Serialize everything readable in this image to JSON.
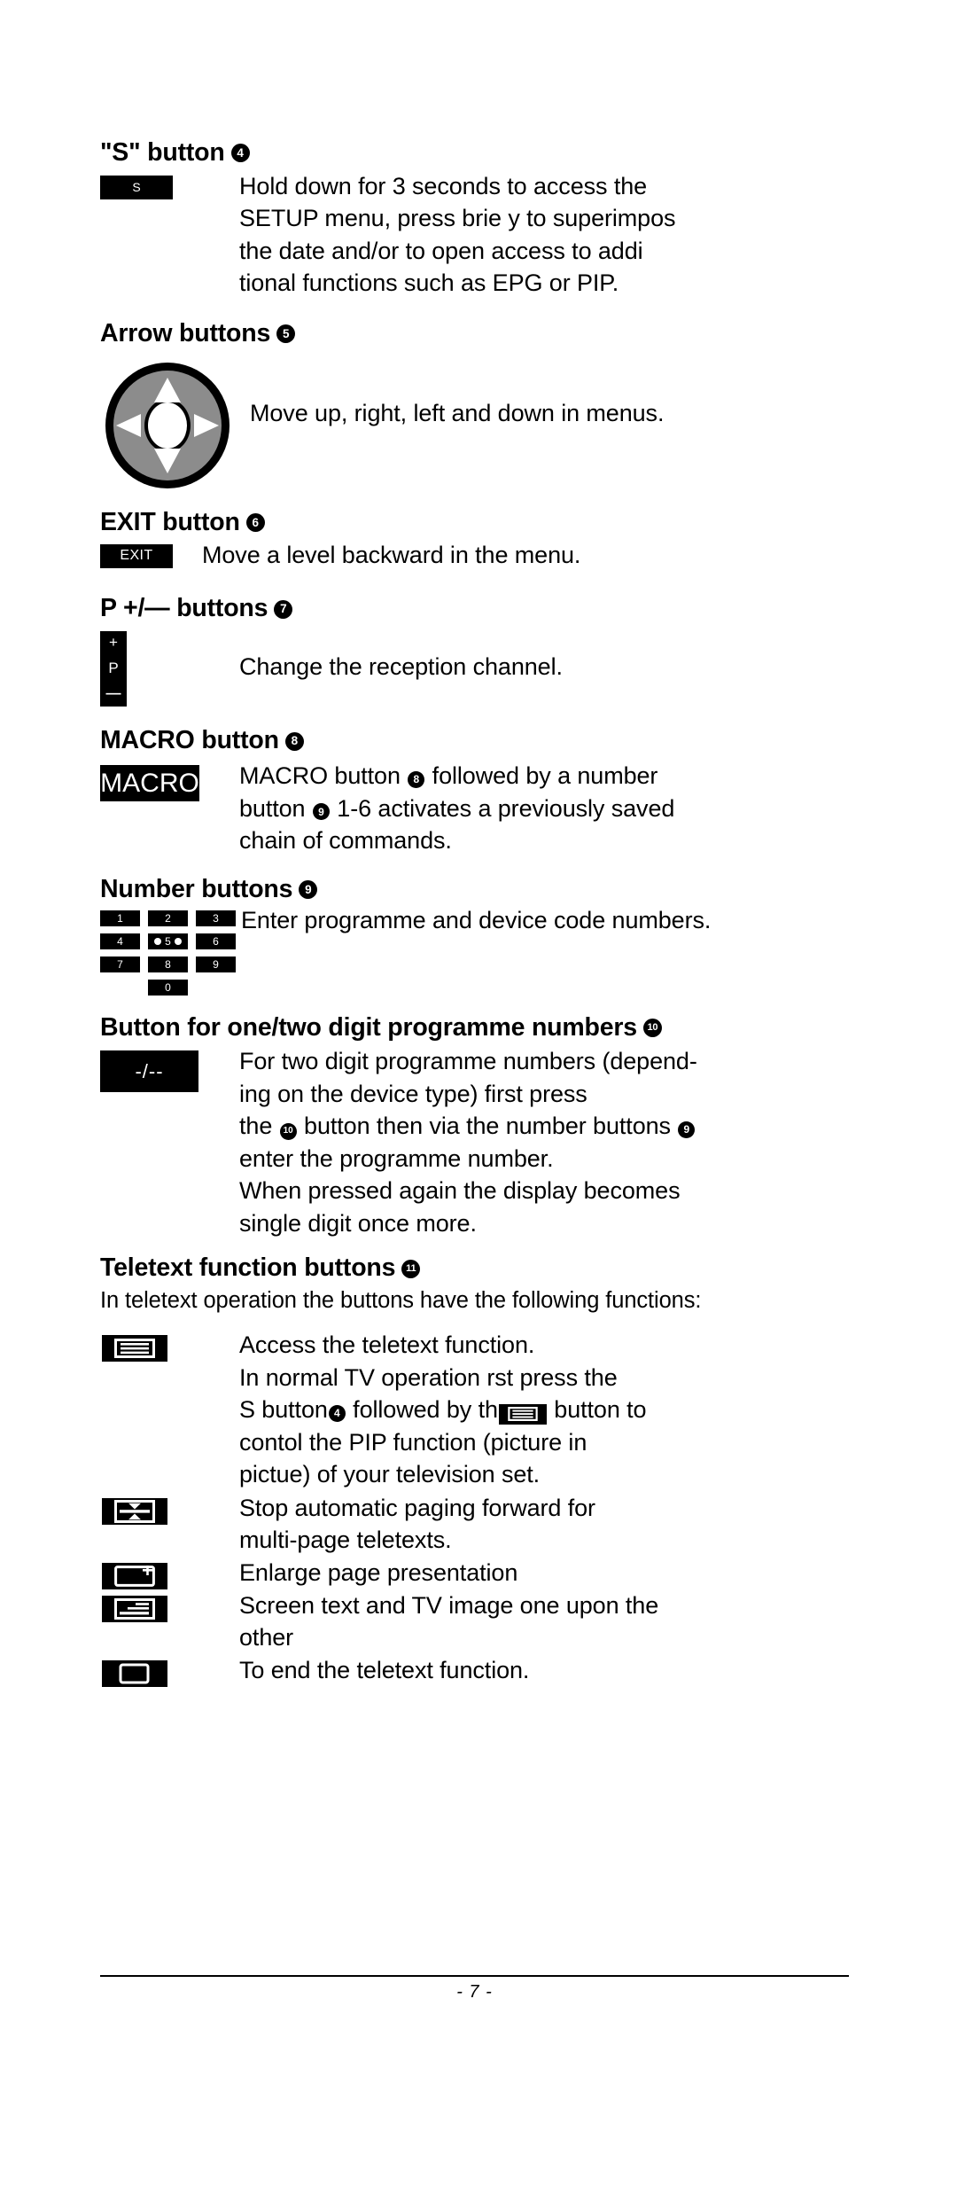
{
  "document": {
    "page_number": "- 7 -"
  },
  "sections": [
    {
      "id": "s-button",
      "heading": "\"S\" button",
      "marker": "4",
      "key_label": "S",
      "lines": [
        "Hold down for 3 seconds to access the",
        "SETUP menu, press brie y to superimpos",
        "the date and/or to open access to addi",
        "tional functions such as EPG or PIP."
      ]
    },
    {
      "id": "arrow-buttons",
      "heading": "Arrow buttons",
      "marker": "5",
      "lines": [
        "Move up, right, left and down in menus."
      ]
    },
    {
      "id": "exit-button",
      "heading": "EXIT button",
      "marker": "6",
      "key_label": "EXIT",
      "lines": [
        "Move a level backward in the menu."
      ]
    },
    {
      "id": "p-plus-minus-buttons",
      "heading": "P +/— buttons",
      "marker": "7",
      "key_plus": "+",
      "key_p": "P",
      "key_minus": "—",
      "lines": [
        "Change the reception channel."
      ]
    },
    {
      "id": "macro-button",
      "heading": "MACRO button",
      "marker": "8",
      "key_label": "MACRO",
      "rich_lines": [
        {
          "parts": [
            "MACRO button ",
            "@8",
            " followed by a number"
          ]
        },
        {
          "parts": [
            "button ",
            "@9",
            " 1-6 activates a previously saved"
          ]
        },
        {
          "parts": [
            "chain of commands."
          ]
        }
      ]
    },
    {
      "id": "number-buttons",
      "heading": "Number buttons",
      "marker": "9",
      "keys": [
        "1",
        "2",
        "3",
        "4",
        "5",
        "6",
        "7",
        "8",
        "9",
        "0"
      ],
      "lines": [
        "Enter programme and device code numbers."
      ]
    },
    {
      "id": "one-two-digit-button",
      "heading": "Button for one/two digit programme numbers",
      "marker": "10",
      "key_label": "-/--",
      "rich_lines": [
        {
          "parts": [
            "For two digit programme numbers (depend-"
          ]
        },
        {
          "parts": [
            "ing on the device type) first press"
          ]
        },
        {
          "parts": [
            "the ",
            "@10",
            " button then via the number buttons ",
            "@9"
          ]
        },
        {
          "parts": [
            "enter the programme number."
          ]
        },
        {
          "parts": [
            "When pressed again the display becomes"
          ]
        },
        {
          "parts": [
            "single digit once more."
          ]
        }
      ]
    },
    {
      "id": "teletext-function-buttons",
      "heading": "Teletext function buttons",
      "marker": "11",
      "intro": "In teletext operation the buttons have the following functions:",
      "rows": [
        {
          "icon": "teletext-lines-icon",
          "rich_lines": [
            {
              "parts": [
                "Access the teletext function."
              ]
            },
            {
              "parts": [
                "In normal TV operation  rst press the"
              ]
            },
            {
              "parts": [
                "S button",
                "@4",
                " followed by th",
                "@ICON",
                " button to"
              ]
            },
            {
              "parts": [
                "cont",
                "ol the  PIP  function (picture in"
              ]
            },
            {
              "parts": [
                "pictu",
                "e) of your television set."
              ]
            }
          ]
        },
        {
          "icon": "teletext-hold-icon",
          "lines": [
            "Stop automatic paging forward for",
            "multi-page teletexts."
          ]
        },
        {
          "icon": "teletext-enlarge-icon",
          "lines": [
            "Enlarge page presentation"
          ]
        },
        {
          "icon": "teletext-mix-icon",
          "lines": [
            "Screen text and TV image one upon the",
            "other"
          ]
        },
        {
          "icon": "teletext-off-icon",
          "lines": [
            "To end the teletext function."
          ]
        }
      ]
    }
  ],
  "colors": {
    "ink": "#000000",
    "paper": "#ffffff",
    "arrowpad_fill": "#8c8c8c"
  }
}
